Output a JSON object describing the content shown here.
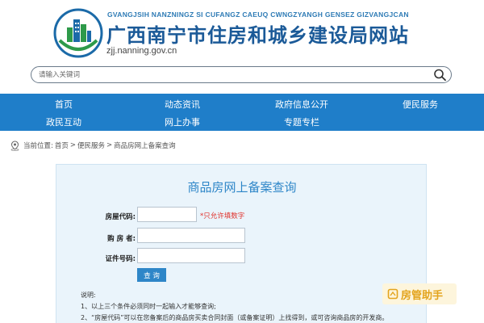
{
  "header": {
    "tagline": "GVANGJSIH NANZNINGZ SI CUFANGZ CAEUQ CWNGZYANGH GENSEZ GIZVANGJCAN",
    "title": "广西南宁市住房和城乡建设局网站",
    "url": "zjj.nanning.gov.cn",
    "logo_icon": "city-buildings-logo"
  },
  "search": {
    "placeholder": "请输入关键词",
    "icon": "search-icon"
  },
  "nav": {
    "items": [
      {
        "label": "首页"
      },
      {
        "label": "动态资讯"
      },
      {
        "label": "政府信息公开"
      },
      {
        "label": "便民服务"
      },
      {
        "label": "政民互动"
      },
      {
        "label": "网上办事"
      },
      {
        "label": "专题专栏"
      }
    ]
  },
  "breadcrumb": {
    "prefix": "当前位置:",
    "items": [
      "首页",
      "便民服务",
      "商品房网上备案查询"
    ],
    "separator": ">"
  },
  "form": {
    "title": "商品房网上备案查询",
    "fields": [
      {
        "label": "房屋代码:",
        "value": "",
        "hint": "*只允许填数字"
      },
      {
        "label": "购 房 者:",
        "value": ""
      },
      {
        "label": "证件号码:",
        "value": ""
      }
    ],
    "submit_label": "查 询"
  },
  "notes": {
    "heading": "说明:",
    "items": [
      "1、以上三个条件必须同时一起输入才能够查询;",
      "2、“房屋代码”可以在您备案后的商品房买卖合同封面（或备案证明）上找得到，或可咨询商品房的开发商。"
    ]
  },
  "watermark": {
    "text": "房管助手"
  },
  "colors": {
    "nav_bg": "#1f7ec9",
    "title_blue": "#1b5a98",
    "panel_bg": "#eaf4fb",
    "accent": "#2e86c8",
    "hint_red": "#e0302a",
    "watermark_text": "#e3a41d"
  }
}
